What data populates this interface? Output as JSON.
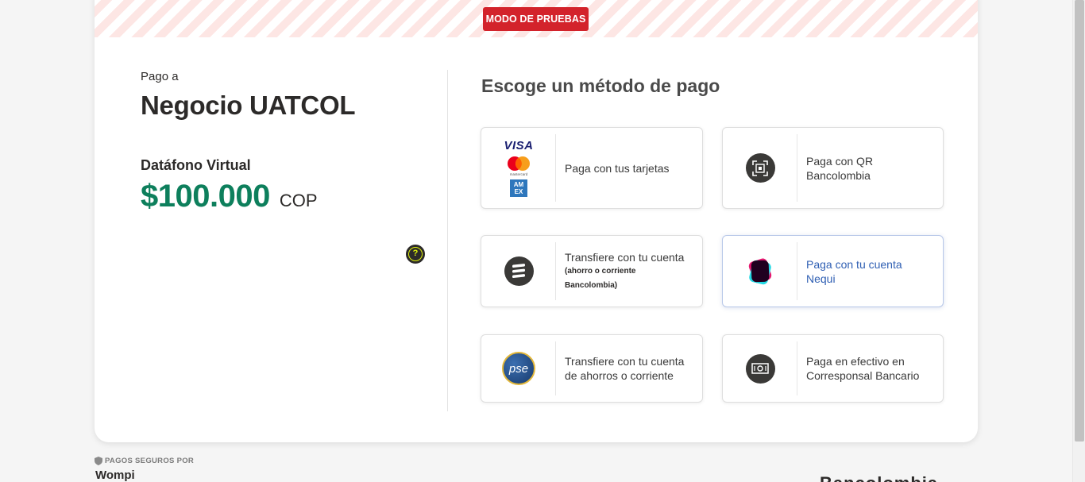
{
  "banner": {
    "test_mode": "MODO DE PRUEBAS"
  },
  "summary": {
    "pay_to_label": "Pago a",
    "merchant_name": "Negocio UATCOL",
    "product_name": "Datáfono Virtual",
    "amount": "$100.000",
    "currency": "COP",
    "help_symbol": "?"
  },
  "methods": {
    "title": "Escoge un método de pago",
    "items": [
      {
        "label": "Paga con tus tarjetas",
        "icon": "card-brands-icon"
      },
      {
        "label": "Paga con QR Bancolombia",
        "icon": "qr-icon"
      },
      {
        "label": "Transfiere con tu cuenta",
        "sublabel": "(ahorro o corriente Bancolombia)",
        "icon": "bancolombia-icon"
      },
      {
        "label": "Paga con tu cuenta Nequi",
        "icon": "nequi-icon",
        "selected": true
      },
      {
        "label": "Transfiere con tu cuenta de ahorros o corriente",
        "icon": "pse-icon"
      },
      {
        "label": "Paga en efectivo en Corresponsal Bancario",
        "icon": "cash-icon"
      }
    ],
    "card_brands": {
      "visa": "VISA",
      "mastercard": "mastercard",
      "amex_top": "AM",
      "amex_bottom": "EX"
    },
    "pse_text": "pse"
  },
  "footer": {
    "secure_label": "PAGOS SEGUROS POR",
    "brand": "Wompi",
    "right_brand": "Bancolombia"
  },
  "colors": {
    "accent_green": "#0d7f5c",
    "test_red": "#d3232b",
    "selected_blue": "#2f5fb3"
  }
}
